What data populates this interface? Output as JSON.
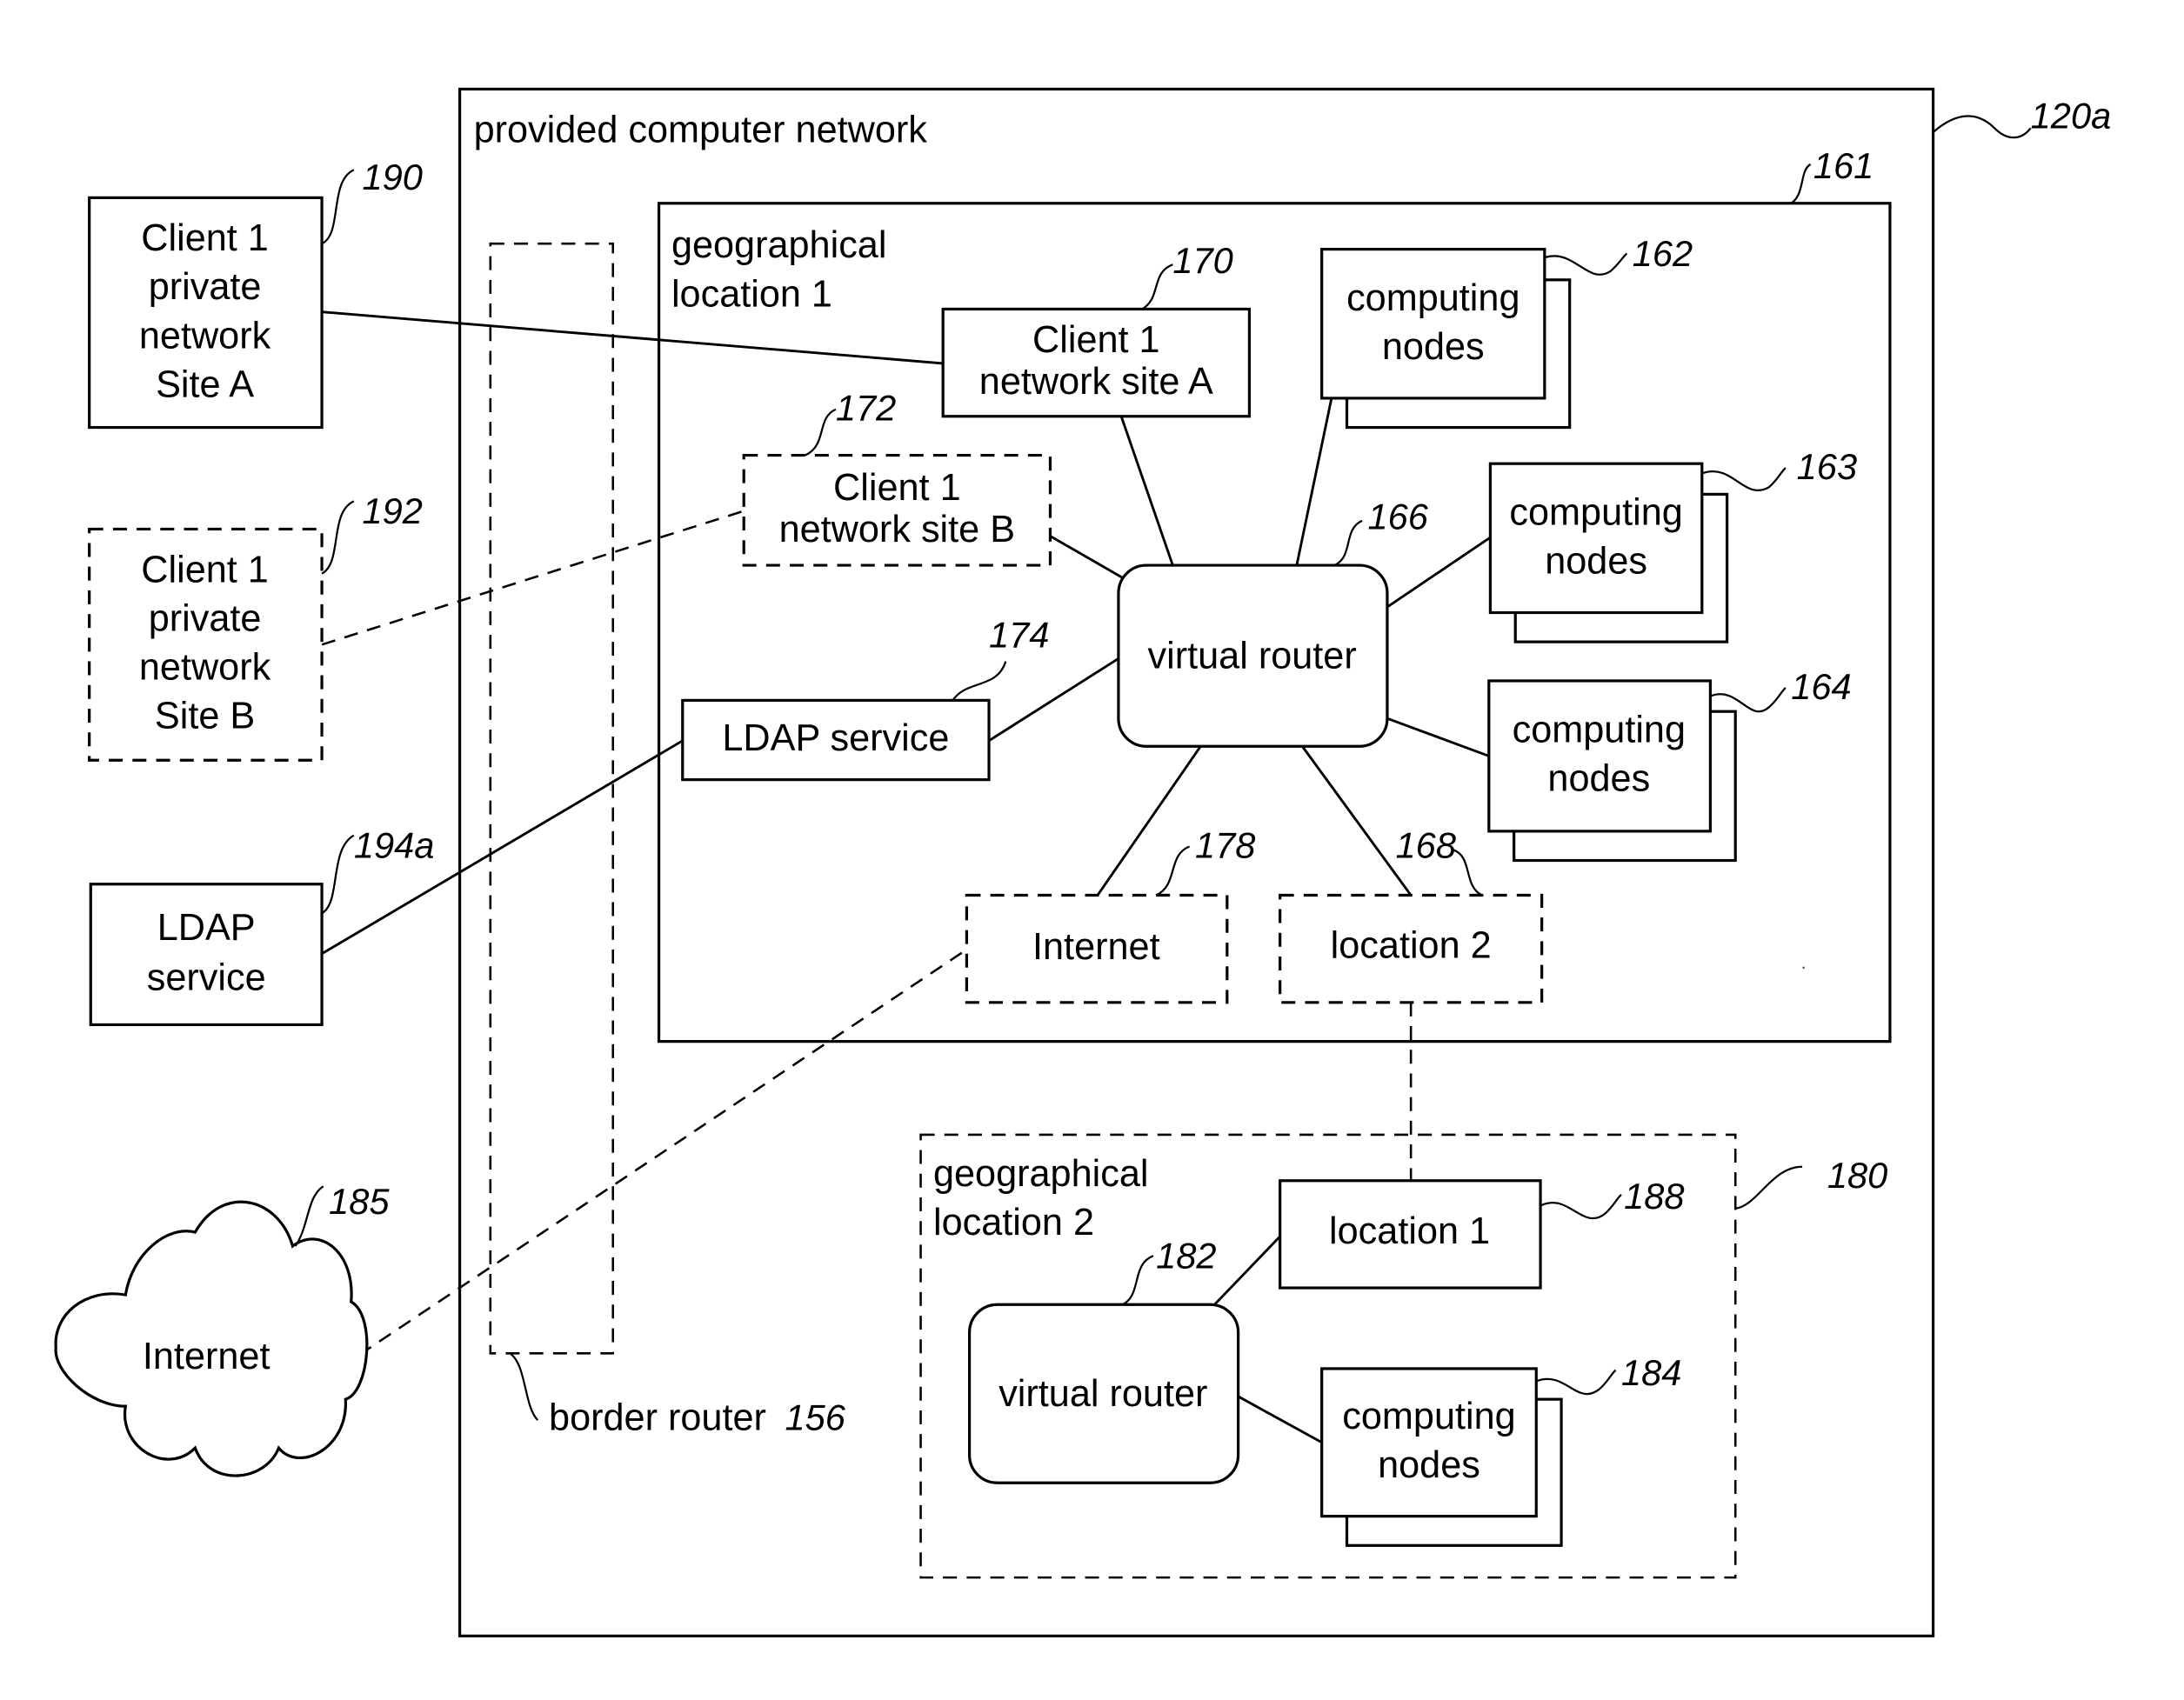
{
  "diagram": {
    "outer": {
      "title": "provided computer network",
      "ref": "120a"
    },
    "geo1": {
      "title_line1": "geographical",
      "title_line2": "location 1",
      "ref": "161"
    },
    "geo2": {
      "title_line1": "geographical",
      "title_line2": "location 2",
      "ref": "180"
    },
    "border_router": {
      "label": "border router",
      "ref": "156"
    },
    "external": {
      "site_a": {
        "lines": [
          "Client 1",
          "private",
          "network",
          "Site A"
        ],
        "ref": "190"
      },
      "site_b": {
        "lines": [
          "Client 1",
          "private",
          "network",
          "Site B"
        ],
        "ref": "192"
      },
      "ldap": {
        "lines": [
          "LDAP",
          "service"
        ],
        "ref": "194a"
      },
      "internet": {
        "label": "Internet",
        "ref": "185"
      }
    },
    "loc1_nodes": {
      "site_a": {
        "lines": [
          "Client 1",
          "network site A"
        ],
        "ref": "170"
      },
      "site_b": {
        "lines": [
          "Client 1",
          "network site B"
        ],
        "ref": "172"
      },
      "ldap": {
        "label": "LDAP service",
        "ref": "174"
      },
      "router": {
        "label": "virtual router",
        "ref": "166"
      },
      "nodes_162": {
        "lines": [
          "computing",
          "nodes"
        ],
        "ref": "162"
      },
      "nodes_163": {
        "lines": [
          "computing",
          "nodes"
        ],
        "ref": "163"
      },
      "nodes_164": {
        "lines": [
          "computing",
          "nodes"
        ],
        "ref": "164"
      },
      "internet": {
        "label": "Internet",
        "ref": "178"
      },
      "location2": {
        "label": "location 2",
        "ref": "168"
      }
    },
    "loc2_nodes": {
      "location1": {
        "label": "location 1",
        "ref": "188"
      },
      "router": {
        "label": "virtual router",
        "ref": "182"
      },
      "nodes_184": {
        "lines": [
          "computing",
          "nodes"
        ],
        "ref": "184"
      }
    }
  }
}
